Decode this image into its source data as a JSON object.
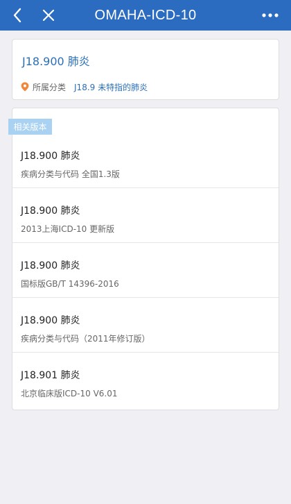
{
  "header": {
    "title": "OMAHA-ICD-10"
  },
  "summary": {
    "code_title": "J18.900 肺炎",
    "category_label": "所属分类",
    "category_value": "J18.9 未特指的肺炎"
  },
  "versions": {
    "badge": "相关版本",
    "items": [
      {
        "title": "J18.900 肺炎",
        "source": "疾病分类与代码 全国1.3版"
      },
      {
        "title": "J18.900 肺炎",
        "source": "2013上海ICD-10 更新版"
      },
      {
        "title": "J18.900 肺炎",
        "source": "国标版GB/T 14396-2016"
      },
      {
        "title": "J18.900 肺炎",
        "source": "疾病分类与代码（2011年修订版）"
      },
      {
        "title": "J18.901 肺炎",
        "source": "北京临床版ICD-10 V6.01"
      }
    ]
  },
  "colors": {
    "header_bg": "#2b6cc1",
    "link": "#2a6fb8",
    "badge_bg": "#a9d1f2",
    "pin": "#f0883a"
  },
  "icons": {
    "back": "chevron-left-icon",
    "close": "close-icon",
    "more": "more-dots-icon",
    "location": "location-pin-icon"
  }
}
